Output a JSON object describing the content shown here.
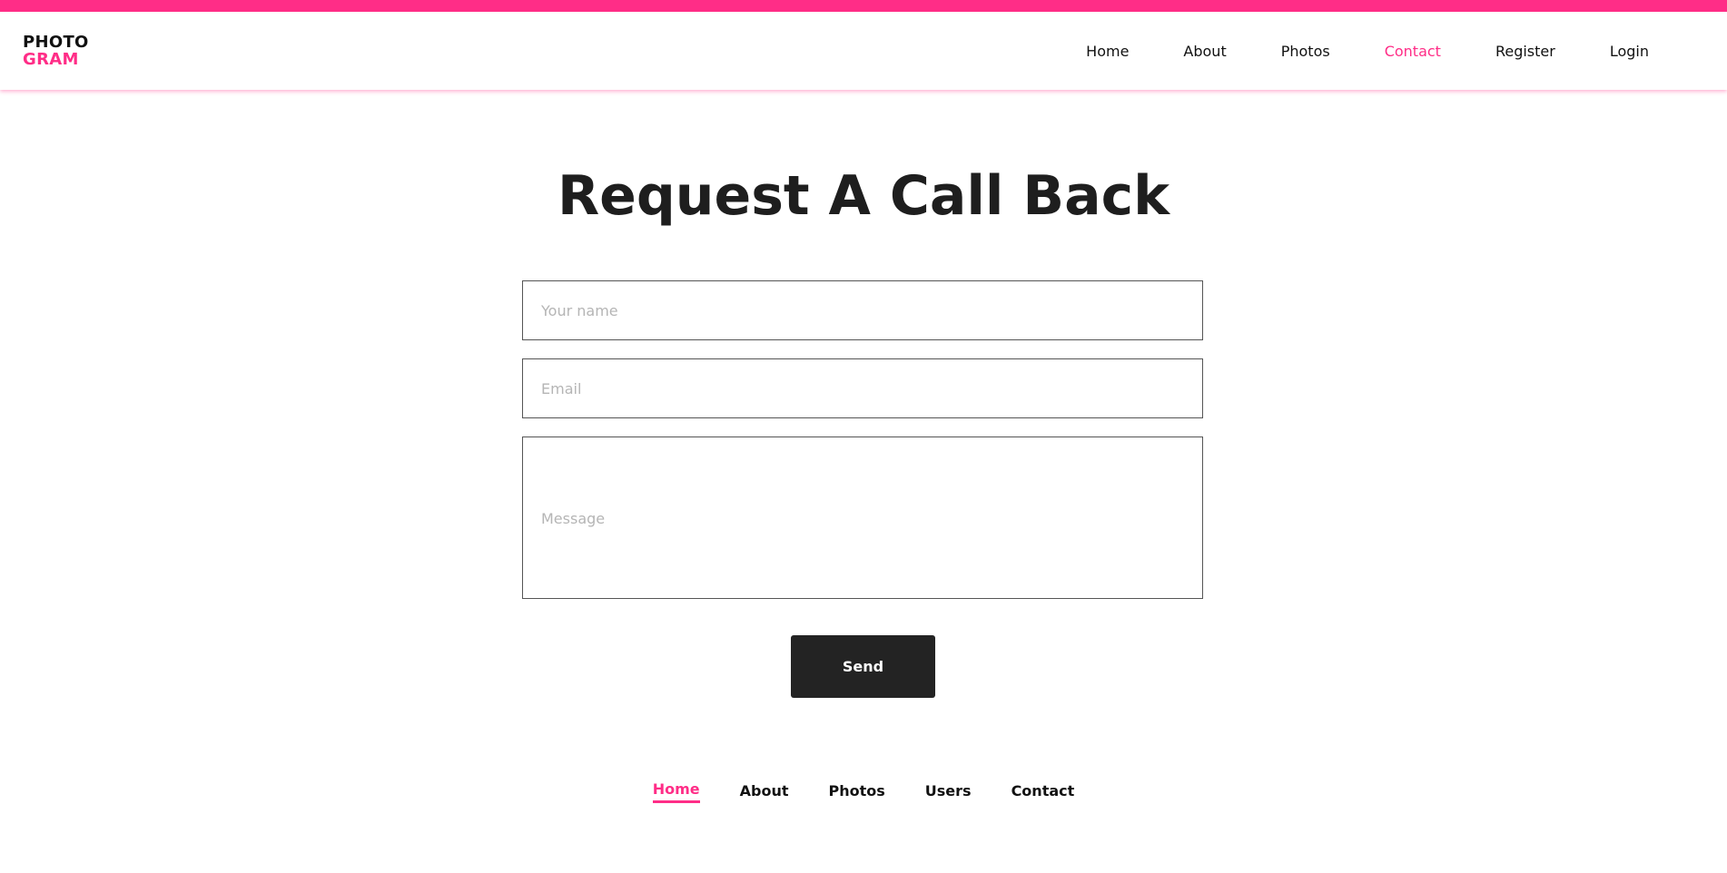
{
  "brand": {
    "logo_line1": "PHOTO",
    "logo_line2": "GRAM",
    "accent_color": "#ff2d87",
    "text_color": "#111111",
    "button_color": "#232323"
  },
  "nav": {
    "items": [
      {
        "label": "Home",
        "active": false
      },
      {
        "label": "About",
        "active": false
      },
      {
        "label": "Photos",
        "active": false
      },
      {
        "label": "Contact",
        "active": true
      },
      {
        "label": "Register",
        "active": false
      },
      {
        "label": "Login",
        "active": false
      }
    ]
  },
  "main": {
    "title": "Request A Call Back",
    "form": {
      "name_placeholder": "Your name",
      "name_value": "",
      "email_placeholder": "Email",
      "email_value": "",
      "message_placeholder": "Message",
      "message_value": "",
      "send_label": "Send"
    }
  },
  "footer": {
    "items": [
      {
        "label": "Home",
        "active": true
      },
      {
        "label": "About",
        "active": false
      },
      {
        "label": "Photos",
        "active": false
      },
      {
        "label": "Users",
        "active": false
      },
      {
        "label": "Contact",
        "active": false
      }
    ]
  }
}
